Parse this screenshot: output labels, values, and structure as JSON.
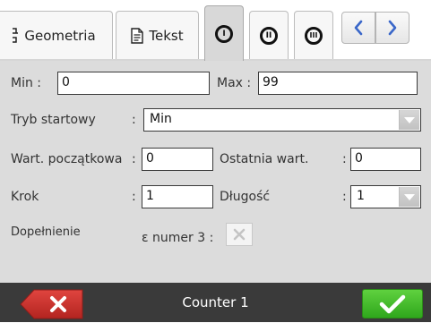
{
  "tabs": {
    "geometria": "Geometria",
    "tekst": "Tekst",
    "counter1_glyph": "I",
    "counter2_glyph": "II",
    "counter3_glyph": "III"
  },
  "form": {
    "min_label": "Min  :",
    "min_value": "0",
    "max_label": "Max :",
    "max_value": "99",
    "start_mode_label": "Tryb startowy",
    "start_mode_colon": ":",
    "start_mode_value": "Min",
    "initial_label": "Wart. początkowa",
    "initial_colon": ":",
    "initial_value": "0",
    "last_label": "Ostatnia wart.",
    "last_colon": ":",
    "last_value": "0",
    "step_label": "Krok",
    "step_colon": ":",
    "step_value": "1",
    "length_label": "Długość",
    "length_colon": ":",
    "length_value": "1",
    "padding_label": "Dopełnienie",
    "padding_sub": "ε numer 3 :"
  },
  "bottom": {
    "title": "Counter 1"
  },
  "colors": {
    "active_tab": "#d8d8d8",
    "panel": "#dcdcdc",
    "bottombar": "#3a3a3a",
    "cancel": "#c9302c",
    "ok": "#3cbf26"
  },
  "icons": {
    "geometria": "geometry-icon",
    "tekst": "text-document-icon",
    "prev": "chevron-left-icon",
    "next": "chevron-right-icon",
    "cancel": "close-icon",
    "ok": "checkmark-icon"
  }
}
